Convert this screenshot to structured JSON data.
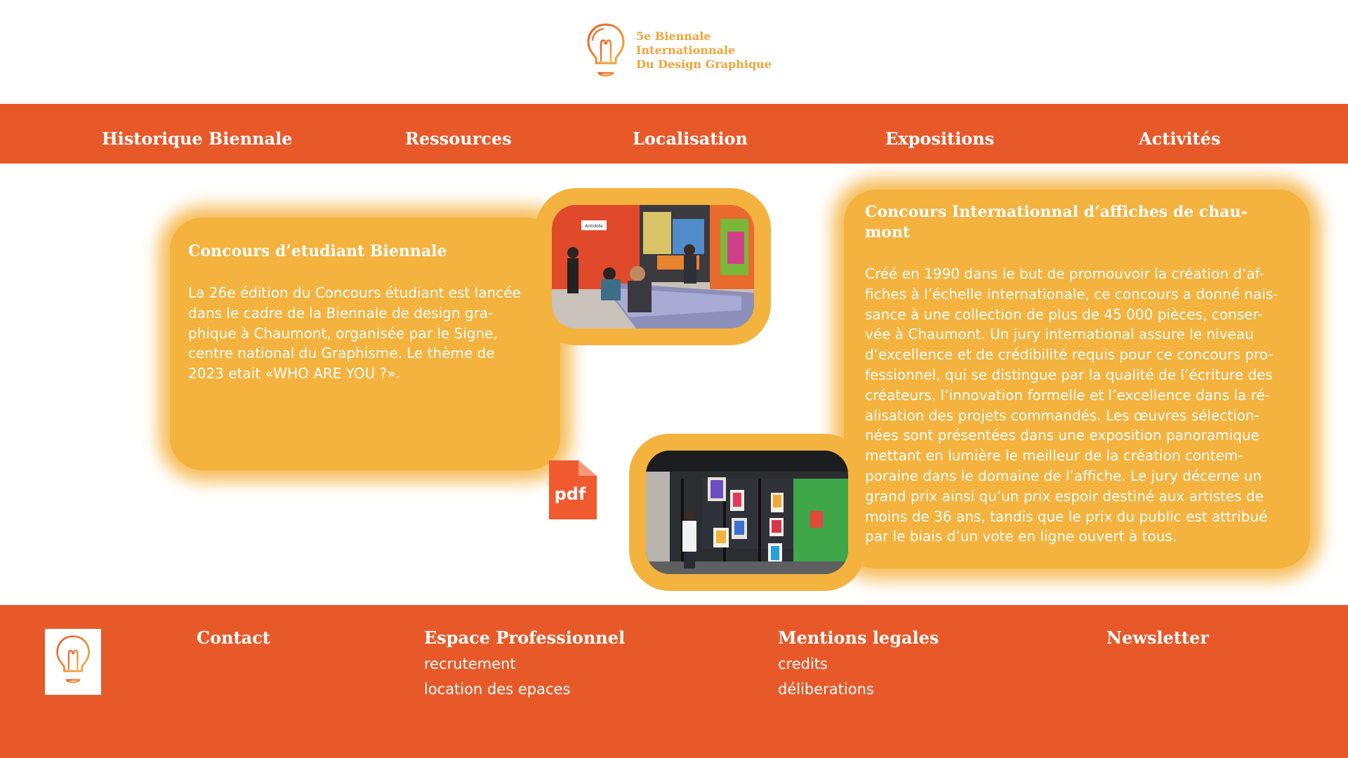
{
  "brand": {
    "name_lines": [
      "5e Biennale",
      "Internationnale",
      "Du Design Graphique"
    ],
    "logo_icon": "lightbulb-icon",
    "colors": {
      "orange": "#e8592a",
      "yellow": "#f4b23e",
      "logo_text": "#f2a33b"
    }
  },
  "nav": {
    "items": [
      {
        "label": "Historique Biennale"
      },
      {
        "label": "Ressources"
      },
      {
        "label": "Localisation"
      },
      {
        "label": "Expositions"
      },
      {
        "label": "Activités"
      }
    ]
  },
  "student_contest": {
    "title": "Concours d’etudiant Biennale",
    "body_lines": [
      "La 26e édition du Concours étudiant est lancée",
      "dans le cadre de la Biennale de design gra-",
      "phique à Chaumont, organisée par le Signe,",
      "centre national du Graphisme. Le thème de",
      "2023 etait «WHO ARE YOU ?»."
    ],
    "pdf_label": "pdf"
  },
  "poster_contest": {
    "title_lines": [
      "Concours Internationnal d’affiches de chau-",
      "mont"
    ],
    "body_lines": [
      "Créé en 1990 dans le but de promouvoir la création d’af-",
      "fiches à l’échelle internationale, ce concours a donné nais-",
      "sance à une collection de plus de 45 000 pièces, conser-",
      "vée à Chaumont. Un jury international assure le niveau",
      "d’excellence et de crédibilité requis pour ce concours pro-",
      "fessionnel, qui se distingue par la qualité de l’écriture des",
      "créateurs, l’innovation formelle et l’excellence dans la ré-",
      "alisation des projets commandés. Les œuvres sélection-",
      "nées sont présentées dans une exposition panoramique",
      "mettant en lumière le meilleur de la création contem-",
      "poraine dans le domaine de l’affiche. Le jury décerne un",
      "grand prix ainsi qu’un prix espoir destiné aux artistes de",
      "moins de 36 ans, tandis que le prix du public est attribué",
      "par le biais d’un vote en ligne ouvert à tous."
    ]
  },
  "exhibit_sign": "Antidote",
  "footer": {
    "contact": "Contact",
    "professional": {
      "heading": "Espace Professionnel",
      "links": [
        "recrutement",
        "location des epaces"
      ]
    },
    "legal": {
      "heading": "Mentions legales",
      "links": [
        "credits",
        "déliberations"
      ]
    },
    "newsletter": "Newsletter"
  }
}
